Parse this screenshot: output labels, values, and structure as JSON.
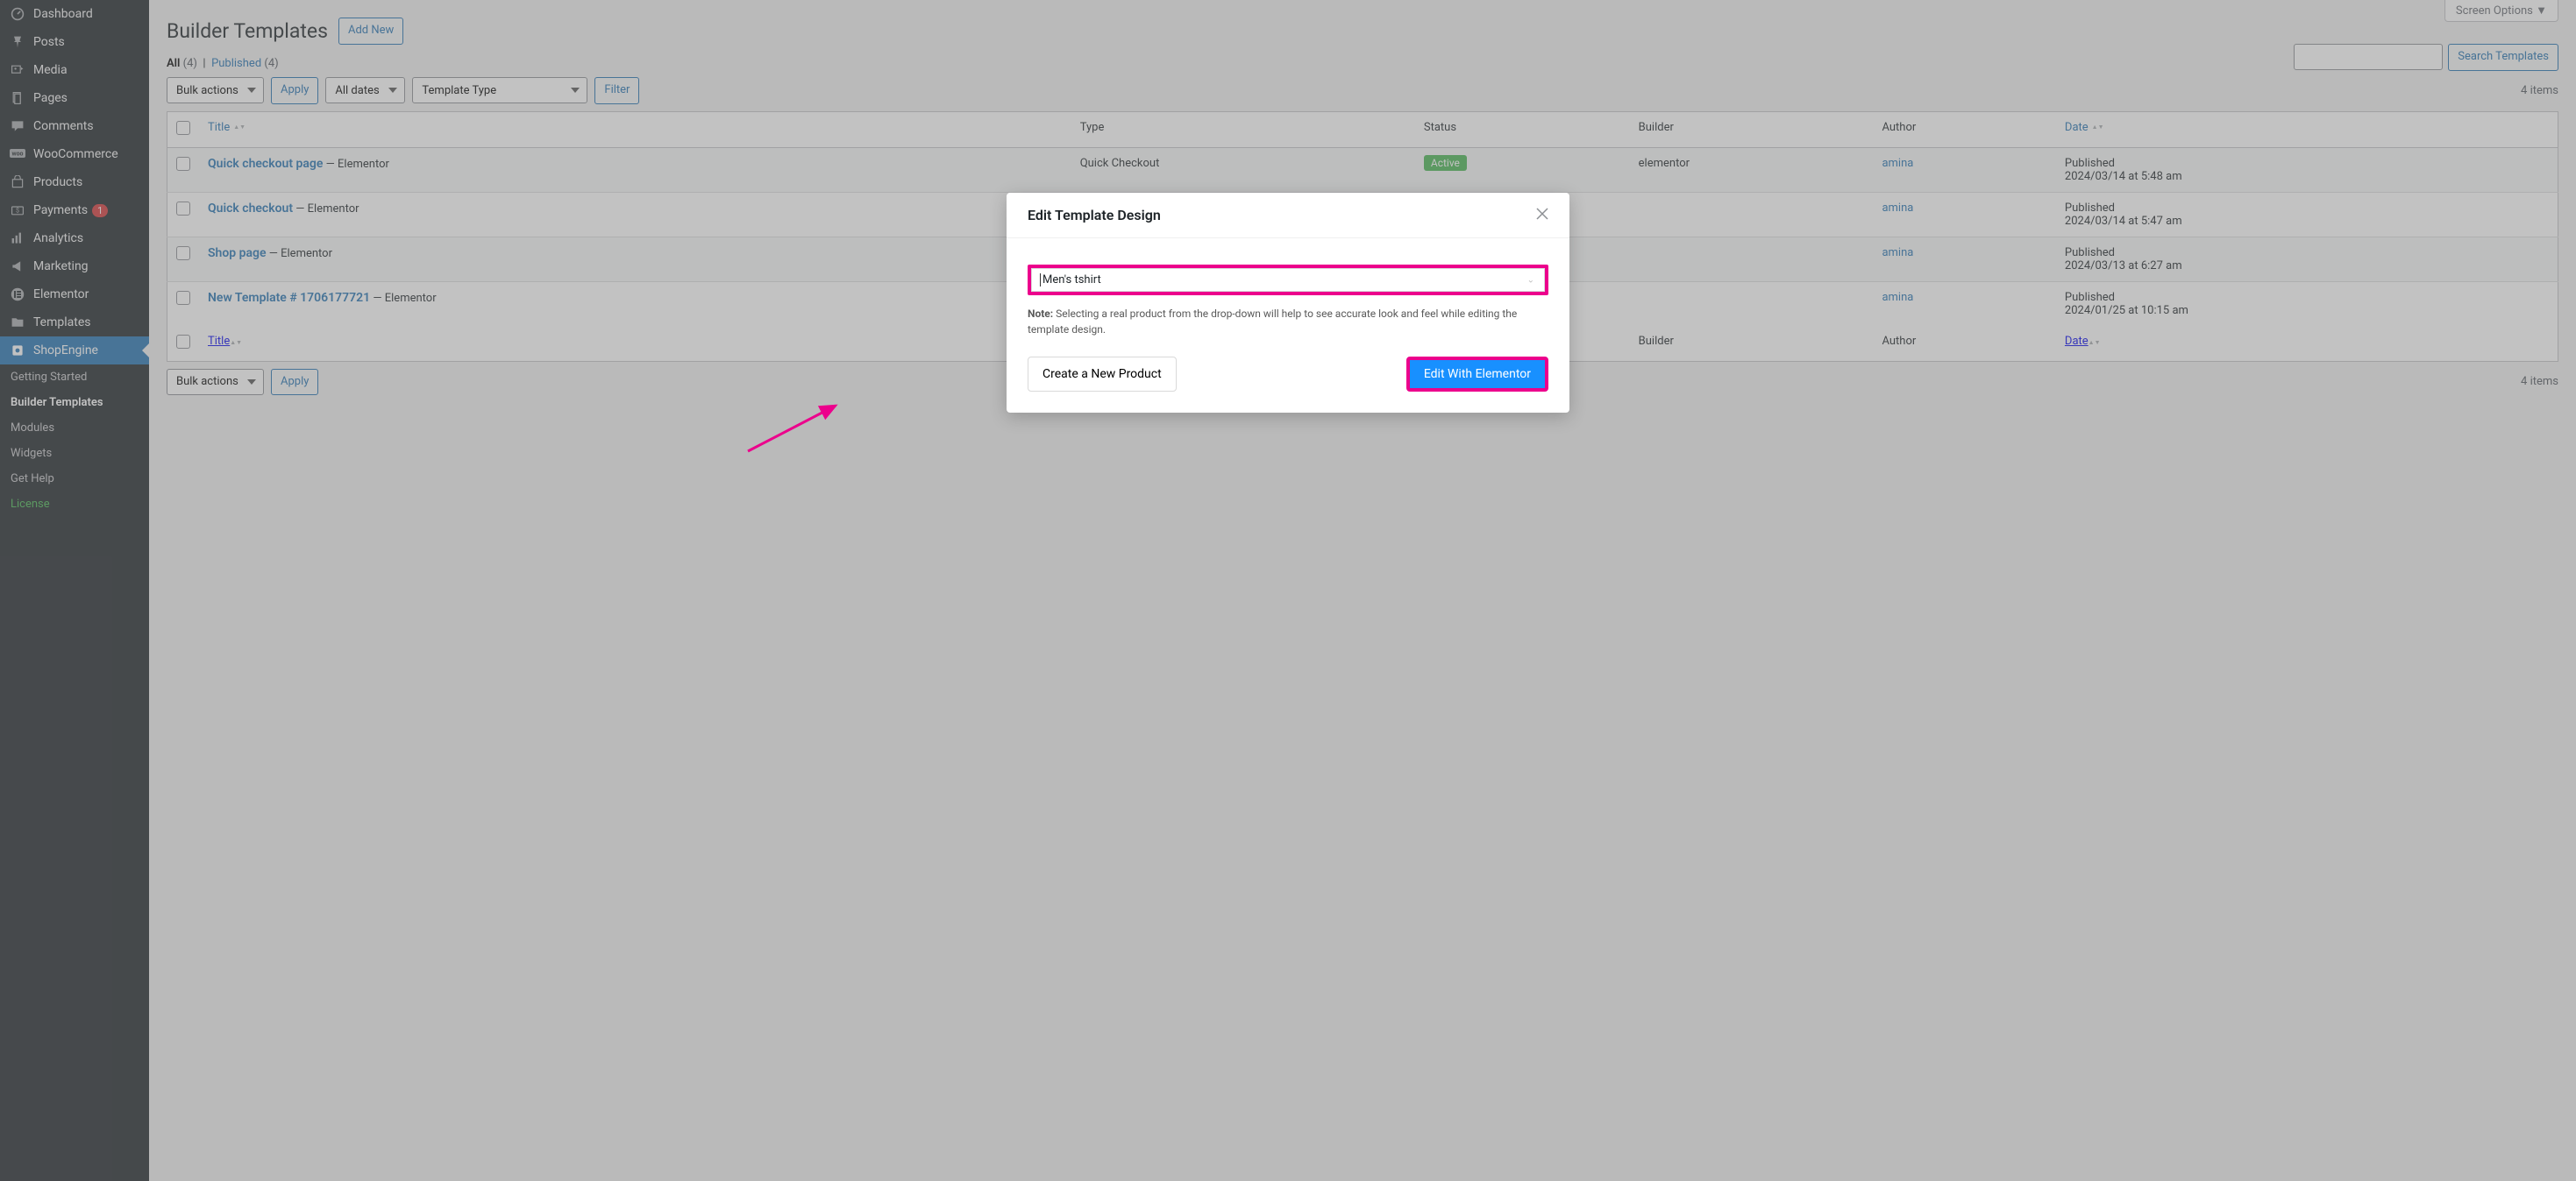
{
  "sidebar": {
    "items": [
      {
        "label": "Dashboard"
      },
      {
        "label": "Posts"
      },
      {
        "label": "Media"
      },
      {
        "label": "Pages"
      },
      {
        "label": "Comments"
      },
      {
        "label": "WooCommerce"
      },
      {
        "label": "Products"
      },
      {
        "label": "Payments",
        "badge": "1"
      },
      {
        "label": "Analytics"
      },
      {
        "label": "Marketing"
      },
      {
        "label": "Elementor"
      },
      {
        "label": "Templates"
      },
      {
        "label": "ShopEngine"
      }
    ],
    "submenu": [
      "Getting Started",
      "Builder Templates",
      "Modules",
      "Widgets",
      "Get Help",
      "License"
    ]
  },
  "header": {
    "screen_options": "Screen Options",
    "page_title": "Builder Templates",
    "add_new": "Add New"
  },
  "subsubsub": {
    "all": "All",
    "all_count": "(4)",
    "sep": "|",
    "published": "Published",
    "pub_count": "(4)"
  },
  "filters": {
    "bulk": "Bulk actions",
    "apply": "Apply",
    "dates": "All dates",
    "type": "Template Type",
    "filter": "Filter",
    "search_btn": "Search Templates",
    "items": "4 items"
  },
  "columns": {
    "title": "Title",
    "type": "Type",
    "status": "Status",
    "builder": "Builder",
    "author": "Author",
    "date": "Date"
  },
  "rows": [
    {
      "title": "Quick checkout page",
      "suffix": " — Elementor",
      "type": "Quick Checkout",
      "status": "Active",
      "builder": "elementor",
      "author": "amina",
      "date_l1": "Published",
      "date_l2": "2024/03/14 at 5:48 am"
    },
    {
      "title": "Quick checkout",
      "suffix": " — Elementor",
      "type": "",
      "status": "",
      "builder": "",
      "author": "amina",
      "date_l1": "Published",
      "date_l2": "2024/03/14 at 5:47 am"
    },
    {
      "title": "Shop page",
      "suffix": " — Elementor",
      "type": "",
      "status": "",
      "builder": "",
      "author": "amina",
      "date_l1": "Published",
      "date_l2": "2024/03/13 at 6:27 am"
    },
    {
      "title": "New Template # 1706177721",
      "suffix": " — Elementor",
      "type": "",
      "status": "",
      "builder": "",
      "author": "amina",
      "date_l1": "Published",
      "date_l2": "2024/01/25 at 10:15 am"
    }
  ],
  "bottom": {
    "bulk": "Bulk actions",
    "apply": "Apply",
    "items": "4 items"
  },
  "modal": {
    "title": "Edit Template Design",
    "product": "Men's tshirt",
    "note_label": "Note:",
    "note_text": " Selecting a real product from the drop-down will help to see accurate look and feel while editing the template design.",
    "create": "Create a New Product",
    "edit": "Edit With Elementor"
  }
}
